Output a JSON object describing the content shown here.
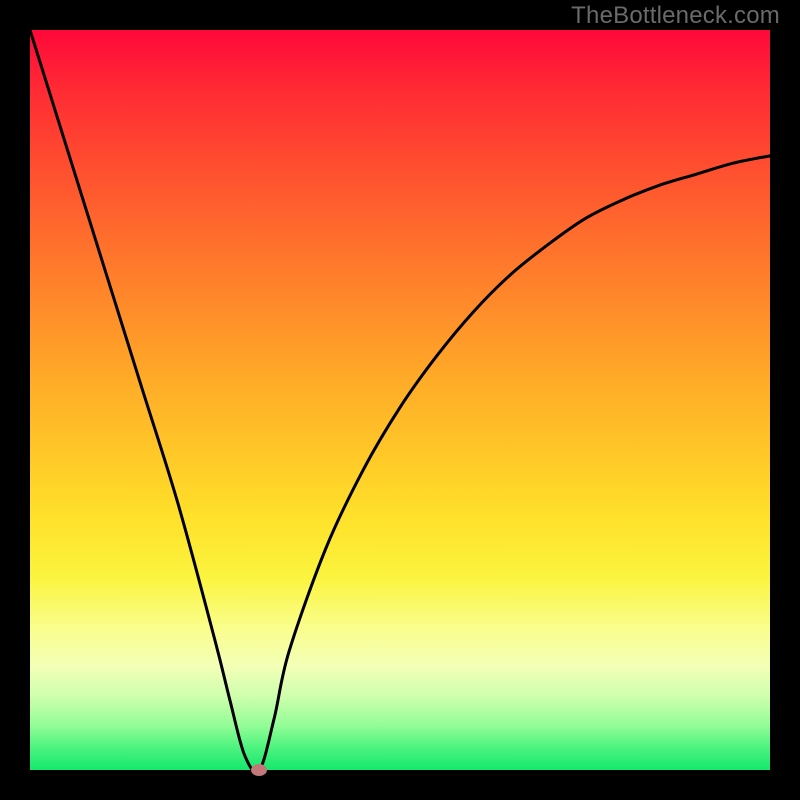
{
  "watermark": "TheBottleneck.com",
  "colors": {
    "frame": "#000000",
    "curve": "#000000",
    "marker": "#c07878",
    "gradient_top": "#ff083a",
    "gradient_bottom": "#14e86d"
  },
  "chart_data": {
    "type": "line",
    "title": "",
    "xlabel": "",
    "ylabel": "",
    "xlim": [
      0,
      100
    ],
    "ylim": [
      0,
      100
    ],
    "grid": false,
    "x": [
      0,
      5,
      10,
      15,
      20,
      25,
      27,
      29,
      31,
      33,
      35,
      40,
      45,
      50,
      55,
      60,
      65,
      70,
      75,
      80,
      85,
      90,
      95,
      100
    ],
    "series": [
      {
        "name": "bottleneck-curve",
        "values": [
          100,
          84,
          68,
          52,
          36,
          17.5,
          9.5,
          2,
          0,
          7,
          16,
          30,
          40.5,
          49,
          56,
          62,
          67,
          71,
          74.5,
          77,
          79,
          80.5,
          82,
          83
        ]
      }
    ],
    "annotations": [
      {
        "name": "min-point-marker",
        "x": 31,
        "y": 0
      }
    ]
  }
}
